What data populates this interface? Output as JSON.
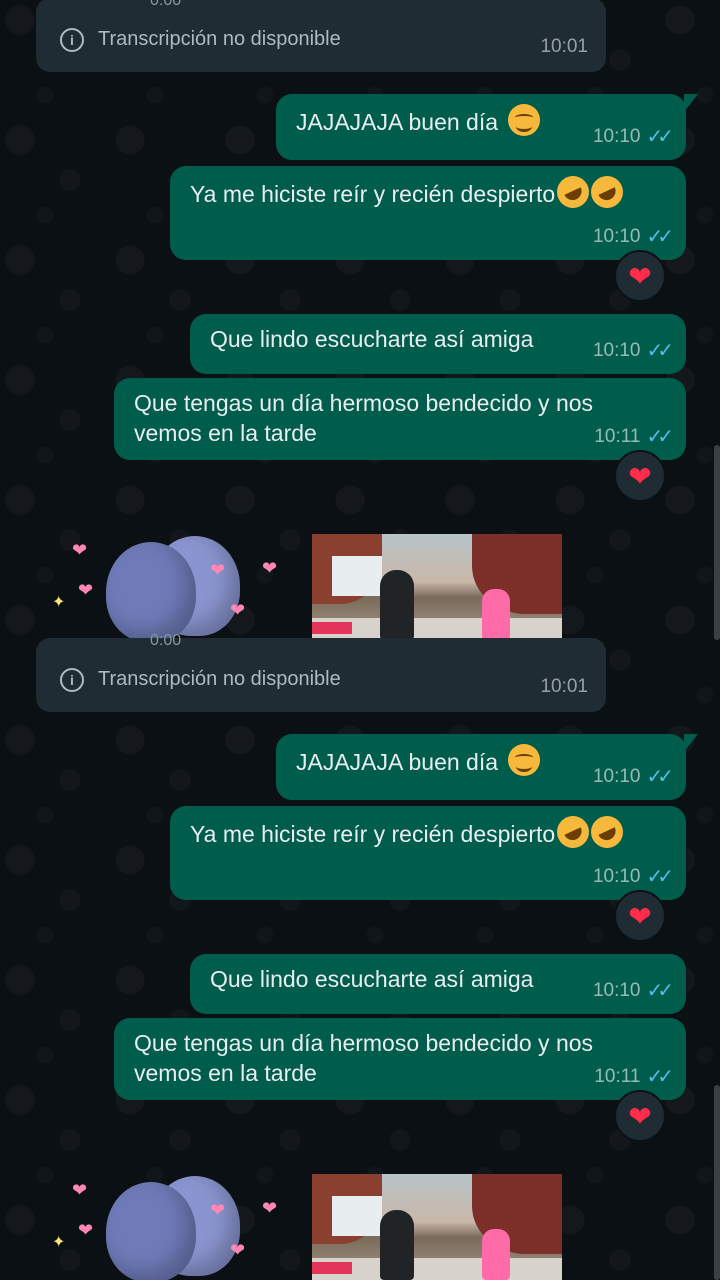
{
  "colors": {
    "background": "#0b1014",
    "outgoing_bubble": "#005c4b",
    "incoming_bubble": "#1f2c34",
    "read_ticks": "#53bdeb",
    "reaction_heart": "#ff2d4a"
  },
  "voice_note": {
    "duration": "0:00",
    "transcription": "Transcripción no disponible",
    "time": "10:01"
  },
  "messages": [
    {
      "text": "JAJAJAJA buen día",
      "emoji": "smiling-face-icon",
      "time": "10:10",
      "status": "read"
    },
    {
      "text": "Ya me hiciste reír y recién despierto",
      "emoji": "rofl-face-icon",
      "time": "10:10",
      "status": "read",
      "reaction": "❤"
    },
    {
      "text": "Que lindo escucharte así amiga",
      "time": "10:10",
      "status": "read"
    },
    {
      "text_line1": "Que tengas un día hermoso bendecido y nos",
      "text_line2": "vemos en la tarde",
      "time": "10:11",
      "status": "read",
      "reaction": "❤"
    }
  ],
  "ticks_glyph": "✓✓",
  "info_glyph": "i",
  "heart_glyph": "❤",
  "sparkle_glyph": "✦"
}
